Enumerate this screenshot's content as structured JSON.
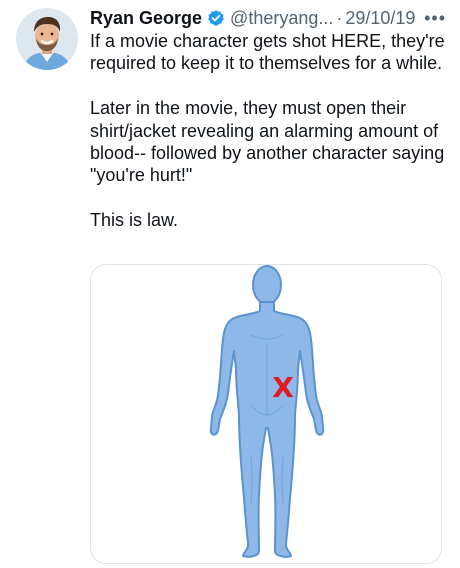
{
  "tweet": {
    "display_name": "Ryan George",
    "handle": "@theryang...",
    "separator": "·",
    "date": "29/10/19",
    "more_icon": "more-horizontal-icon",
    "verified_icon": "verified-badge-icon",
    "paragraphs": [
      "If a movie character gets shot HERE, they're required to keep it to themselves for a while.",
      "Later in the movie, they must open their shirt/jacket revealing an alarming amount of blood-- followed by another character saying \"you're hurt!\"",
      "This is law."
    ]
  },
  "media": {
    "description_icon": "human-body-figure",
    "marker": "X",
    "colors": {
      "body_fill": "#8db8e8",
      "body_stroke": "#5b93cf",
      "marker": "#e01b24"
    }
  },
  "colors": {
    "verified": "#1d9bf0",
    "secondary_text": "#536471",
    "primary_text": "#0f1419"
  }
}
